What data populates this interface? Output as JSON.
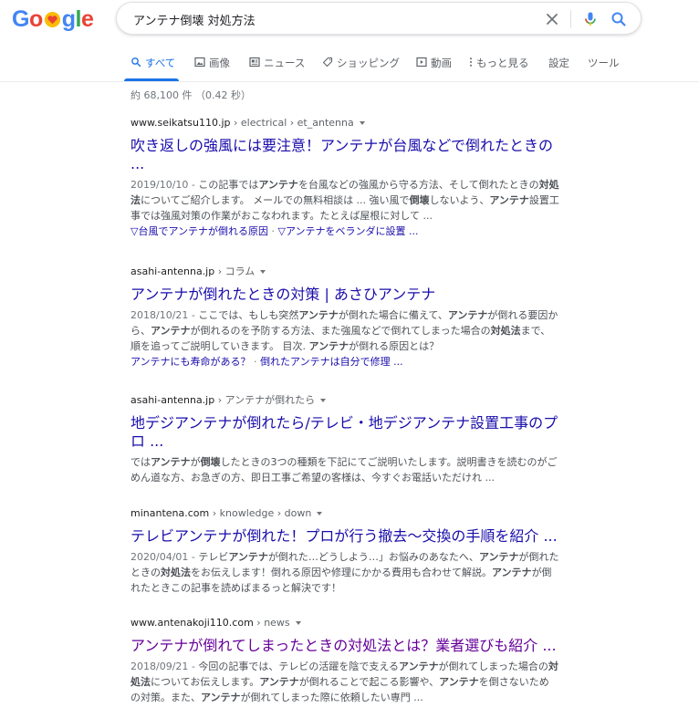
{
  "logo": {
    "letters": [
      "G",
      "o",
      "g",
      "l",
      "e"
    ],
    "colors": {
      "blue": "#4285f4",
      "red": "#ea4335",
      "yellow": "#fbbc05",
      "green": "#34a853"
    },
    "alt": "Google"
  },
  "search": {
    "query": "アンテナ倒壊 対処方法"
  },
  "tabs": [
    {
      "label": "すべて",
      "icon": "search-icon",
      "active": true
    },
    {
      "label": "画像",
      "icon": "image-icon"
    },
    {
      "label": "ニュース",
      "icon": "news-icon"
    },
    {
      "label": "ショッピング",
      "icon": "tag-icon"
    },
    {
      "label": "動画",
      "icon": "video-icon"
    },
    {
      "label": "もっと見る",
      "icon": "more-vert-icon"
    },
    {
      "label": "設定"
    },
    {
      "label": "ツール"
    }
  ],
  "stats": "約 68,100 件 （0.42 秒）",
  "results": [
    {
      "cite_domain": "www.seikatsu110.jp",
      "cite_path": " › electrical › et_antenna",
      "title_line1": "吹き返しの強風には要注意！アンテナが台風などで倒れたときの",
      "title_line2": "...",
      "snippet_lines": [
        [
          {
            "t": "2019/10/10 - ",
            "d": true
          },
          {
            "t": "この記事では"
          },
          {
            "t": "アンテナ",
            "b": true
          },
          {
            "t": "を台風などの強風から守る方法、そして倒れたときの"
          },
          {
            "t": "対処",
            "b": true
          }
        ],
        [
          {
            "t": "法",
            "b": true
          },
          {
            "t": "についてご紹介します。 メールでの無料相談は ... 強い風で"
          },
          {
            "t": "倒壊",
            "b": true
          },
          {
            "t": "しないよう、"
          },
          {
            "t": "アンテナ",
            "b": true
          },
          {
            "t": "設置工"
          }
        ],
        [
          {
            "t": "事では強風対策の作業がおこなわれます。たとえば屋根に対して ..."
          }
        ]
      ],
      "sitelinks": [
        "▽台風でアンテナが倒れる原因",
        "▽アンテナをベランダに設置 ..."
      ]
    },
    {
      "cite_domain": "asahi-antenna.jp",
      "cite_path": " › コラム",
      "title_line1": "アンテナが倒れたときの対策 | あさひアンテナ",
      "snippet_lines": [
        [
          {
            "t": "2018/10/21 - ",
            "d": true
          },
          {
            "t": "ここでは、もしも突然"
          },
          {
            "t": "アンテナ",
            "b": true
          },
          {
            "t": "が倒れた場合に備えて、"
          },
          {
            "t": "アンテナ",
            "b": true
          },
          {
            "t": "が倒れる要因か"
          }
        ],
        [
          {
            "t": "ら、"
          },
          {
            "t": "アンテナ",
            "b": true
          },
          {
            "t": "が倒れるのを予防する方法、また強風などで倒れてしまった場合の"
          },
          {
            "t": "対処法",
            "b": true
          },
          {
            "t": "まで、"
          }
        ],
        [
          {
            "t": "順を追ってご説明していきます。 目次. "
          },
          {
            "t": "アンテナ",
            "b": true
          },
          {
            "t": "が倒れる原因とは？"
          }
        ]
      ],
      "sitelinks": [
        "アンテナにも寿命がある？",
        "倒れたアンテナは自分で修理 ..."
      ]
    },
    {
      "cite_domain": "asahi-antenna.jp",
      "cite_path": " › アンテナが倒れたら",
      "title_line1": "地デジアンテナが倒れたら/テレビ・地デジアンテナ設置工事のプ",
      "title_line2": "ロ ...",
      "snippet_lines": [
        [
          {
            "t": "では"
          },
          {
            "t": "アンテナ",
            "b": true
          },
          {
            "t": "が"
          },
          {
            "t": "倒壊",
            "b": true
          },
          {
            "t": "したときの3つの種類を下記にてご説明いたします。説明書きを読むのがご"
          }
        ],
        [
          {
            "t": "めん道な方、お急ぎの方、即日工事ご希望の客様は、今すぐお電話いただけれ ..."
          }
        ]
      ]
    },
    {
      "cite_domain": "minantena.com",
      "cite_path": " › knowledge › down",
      "title_line1": "テレビアンテナが倒れた！プロが行う撤去〜交換の手順を紹介 ...",
      "snippet_lines": [
        [
          {
            "t": "2020/04/01 - ",
            "d": true
          },
          {
            "t": "テレビ"
          },
          {
            "t": "アンテナ",
            "b": true
          },
          {
            "t": "が倒れた…どうしよう…」お悩みのあなたへ、"
          },
          {
            "t": "アンテナ",
            "b": true
          },
          {
            "t": "が倒れた"
          }
        ],
        [
          {
            "t": "ときの"
          },
          {
            "t": "対処法",
            "b": true
          },
          {
            "t": "をお伝えします！倒れる原因や修理にかかる費用も合わせて解説。"
          },
          {
            "t": "アンテナ",
            "b": true
          },
          {
            "t": "が倒"
          }
        ],
        [
          {
            "t": "れたときこの記事を読めばまるっと解決です！"
          }
        ]
      ]
    },
    {
      "cite_domain": "www.antenakoji110.com",
      "cite_path": " › news",
      "title_line1": "アンテナが倒れてしまったときの対処法とは？業者選びも紹介 ...",
      "visited": true,
      "snippet_lines": [
        [
          {
            "t": "2018/09/21 - ",
            "d": true
          },
          {
            "t": "今回の記事では、テレビの活躍を陰で支える"
          },
          {
            "t": "アンテナ",
            "b": true
          },
          {
            "t": "が倒れてしまった場合の"
          },
          {
            "t": "対",
            "b": true
          }
        ],
        [
          {
            "t": "処法",
            "b": true
          },
          {
            "t": "についてお伝えします。"
          },
          {
            "t": "アンテナ",
            "b": true
          },
          {
            "t": "が倒れることで起こる影響や、"
          },
          {
            "t": "アンテナ",
            "b": true
          },
          {
            "t": "を倒さないため"
          }
        ],
        [
          {
            "t": "の対策。また、"
          },
          {
            "t": "アンテナ",
            "b": true
          },
          {
            "t": "が倒れてしまった際に依頼したい専門 ..."
          }
        ]
      ]
    }
  ]
}
